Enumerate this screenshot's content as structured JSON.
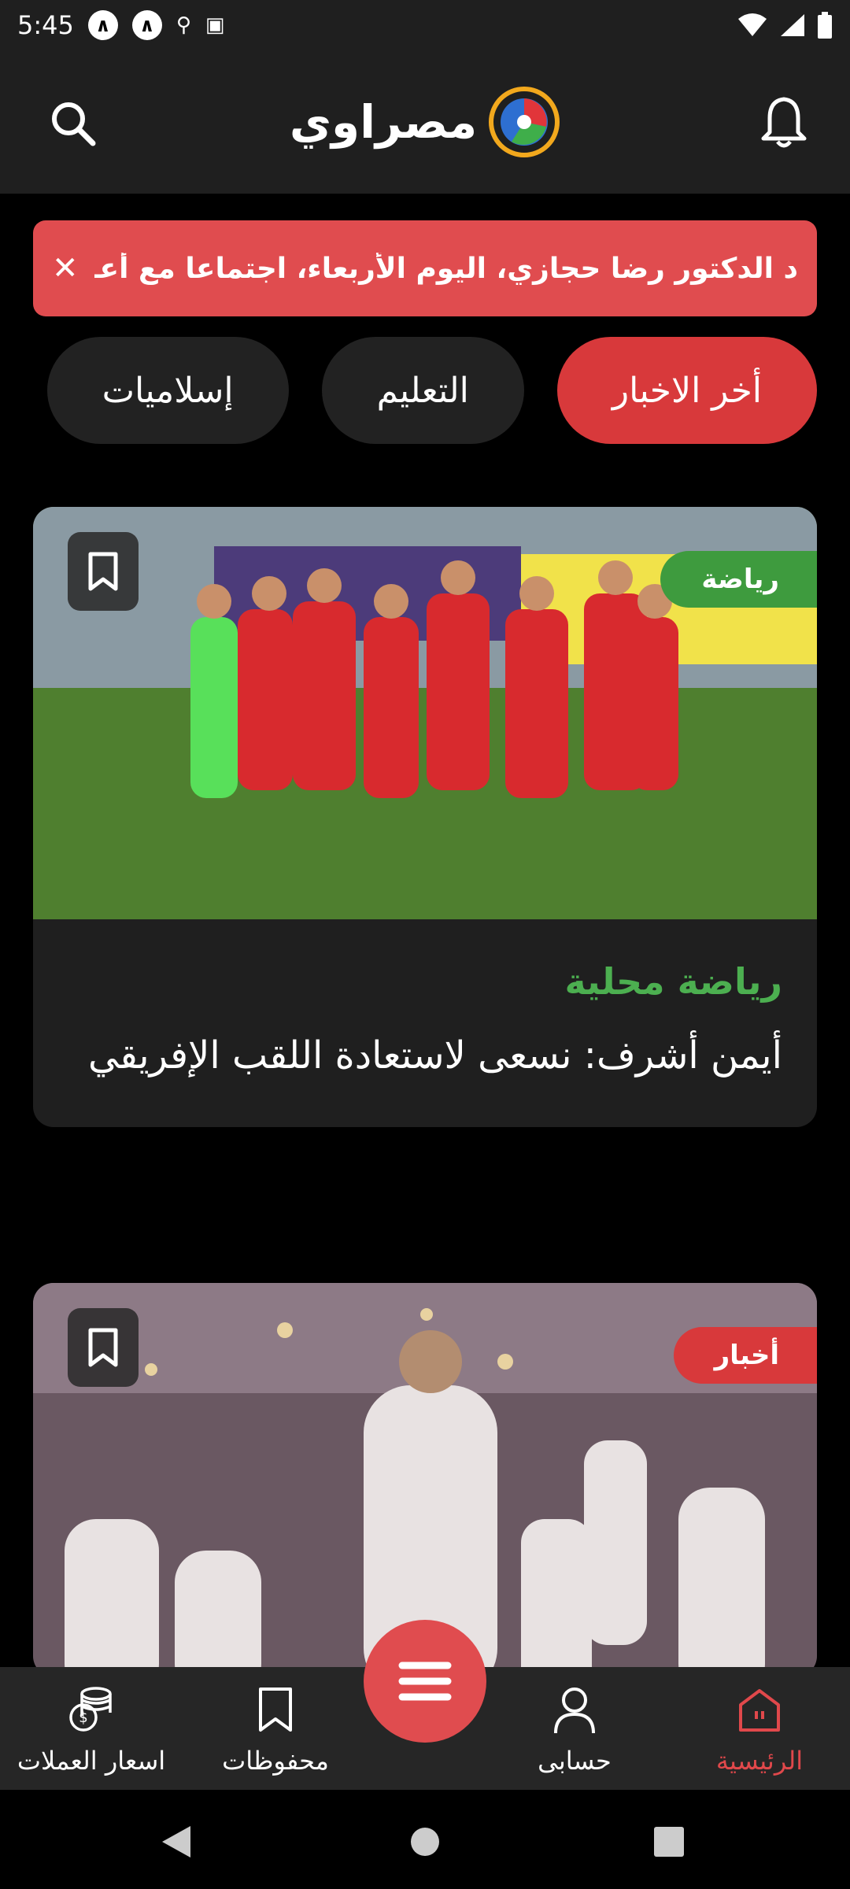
{
  "status_bar": {
    "time": "5:45"
  },
  "header": {
    "logo_text": "مصراوي"
  },
  "ticker": {
    "text": "د الدكتور رضا حجازي، اليوم الأربعاء، اجتماعا مع أعـ",
    "close": "✕"
  },
  "tabs": [
    {
      "label": "أخر الاخبار",
      "active": true
    },
    {
      "label": "التعليم",
      "active": false
    },
    {
      "label": "إسلاميات",
      "active": false
    }
  ],
  "articles": [
    {
      "category": "رياضة",
      "category_color": "#3e9b3e",
      "section": "رياضة محلية",
      "title": "أيمن أشرف: نسعى لاستعادة اللقب الإفريقي"
    },
    {
      "category": "أخبار",
      "category_color": "#d8393b"
    }
  ],
  "bottom_nav": {
    "home": "الرئيسية",
    "account": "حسابى",
    "saved": "محفوظات",
    "currency": "اسعار العملات"
  },
  "colors": {
    "accent": "#e04c4f",
    "sports_green": "#4caf50",
    "background": "#000000",
    "surface": "#1f1f1f"
  }
}
